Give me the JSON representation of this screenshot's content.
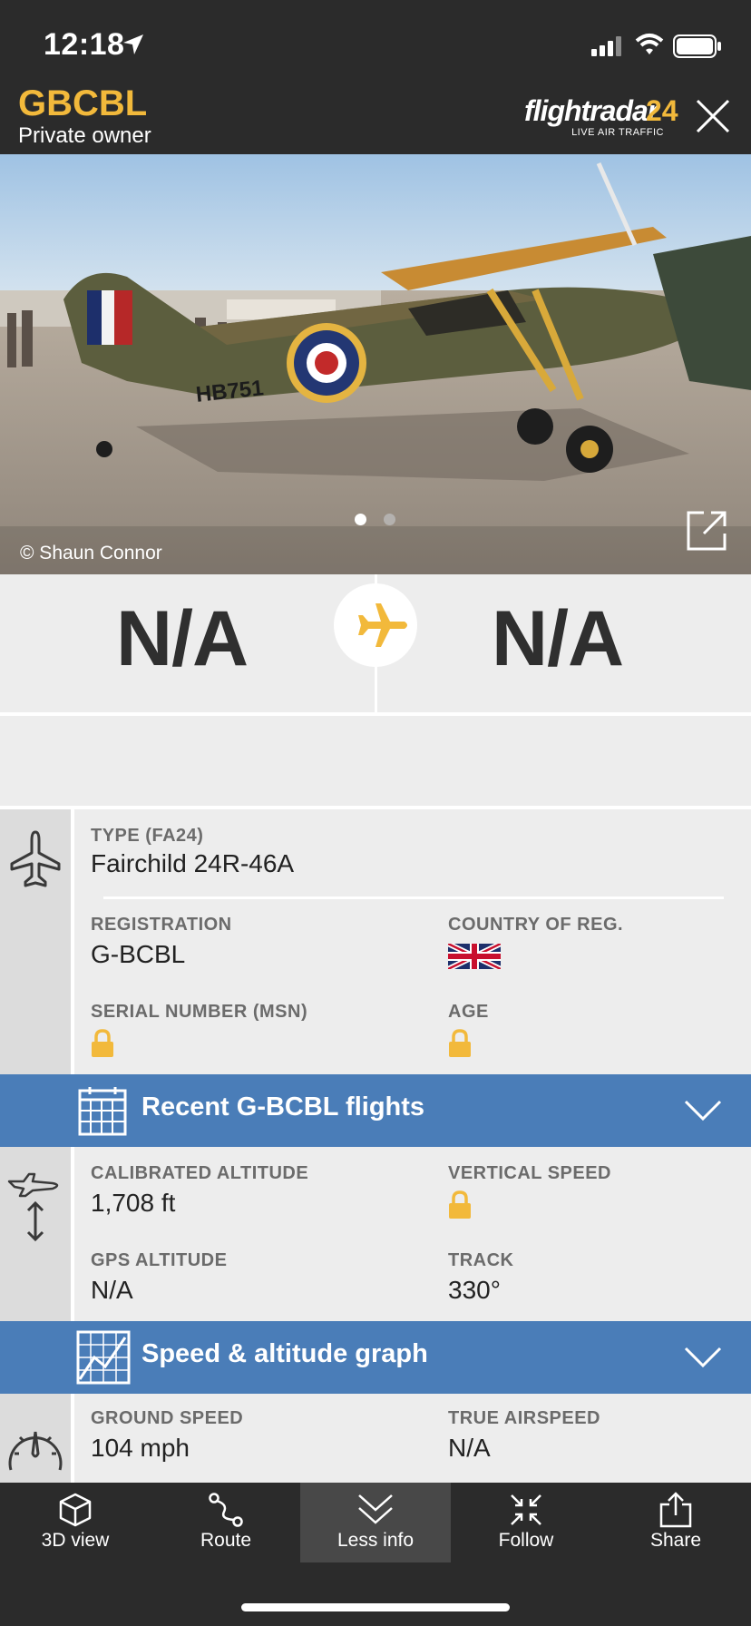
{
  "status_bar": {
    "time": "12:18"
  },
  "header": {
    "registration": "GBCBL",
    "owner": "Private owner",
    "brand_main": "flightradar",
    "brand_num": "24",
    "brand_tagline": "LIVE AIR TRAFFIC"
  },
  "photo": {
    "credit": "© Shaun Connor",
    "tail_marking": "HB751",
    "page_count": 2,
    "current_page": 1
  },
  "route": {
    "from": "N/A",
    "to": "N/A"
  },
  "aircraft": {
    "type_label": "TYPE (FA24)",
    "type_value": "Fairchild 24R-46A",
    "registration_label": "REGISTRATION",
    "registration_value": "G-BCBL",
    "country_label": "COUNTRY OF REG.",
    "serial_label": "SERIAL NUMBER (MSN)",
    "age_label": "AGE"
  },
  "recent_flights_bar": {
    "title": "Recent G-BCBL flights"
  },
  "altitude": {
    "calibrated_label": "CALIBRATED ALTITUDE",
    "calibrated_value": "1,708 ft",
    "vertical_label": "VERTICAL SPEED",
    "gps_label": "GPS ALTITUDE",
    "gps_value": "N/A",
    "track_label": "TRACK",
    "track_value": "330°"
  },
  "graph_bar": {
    "title": "Speed & altitude graph"
  },
  "speed": {
    "ground_label": "GROUND SPEED",
    "ground_value": "104 mph",
    "true_label": "TRUE AIRSPEED",
    "true_value": "N/A"
  },
  "nav": {
    "items": [
      {
        "label": "3D view",
        "icon": "cube-icon"
      },
      {
        "label": "Route",
        "icon": "route-icon"
      },
      {
        "label": "Less info",
        "icon": "chevrons-down-icon"
      },
      {
        "label": "Follow",
        "icon": "follow-icon"
      },
      {
        "label": "Share",
        "icon": "share-icon"
      }
    ],
    "active_index": 2
  },
  "colors": {
    "accent_yellow": "#f2b93b",
    "bar_blue": "#4a7db8",
    "dark_bg": "#2b2b2b"
  }
}
